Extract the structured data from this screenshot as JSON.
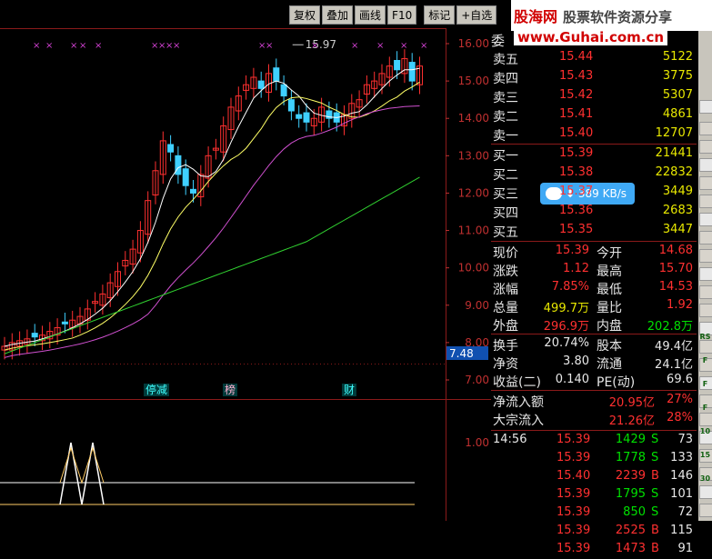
{
  "toolbar": {
    "buttons": [
      "复权",
      "叠加",
      "画线",
      "F10",
      "标记",
      "+自选"
    ]
  },
  "logo": {
    "brand": "股海网",
    "slogan": "股票软件资源分享",
    "url": "www.Guhai.com.cn"
  },
  "chart": {
    "price_axis_ticks": [
      "16.00",
      "15.00",
      "14.00",
      "13.00",
      "12.00",
      "11.00",
      "10.00",
      "9.00",
      "8.00",
      "7.00"
    ],
    "indicator_axis_ticks": [
      "1.00"
    ],
    "high_annotation": "15.97",
    "current_price_marker": "7.48",
    "event_labels": [
      "停减",
      "榜",
      "财"
    ],
    "colors": {
      "up": "#ff3030",
      "down": "#3fd0ff",
      "ma1": "#ffffff",
      "ma2": "#ffff66",
      "ma3": "#d050d0",
      "ma4": "#30d030"
    }
  },
  "order_book": {
    "title": "委",
    "asks": [
      {
        "label": "卖五",
        "price": "15.44",
        "vol": "5122"
      },
      {
        "label": "卖四",
        "price": "15.43",
        "vol": "3775"
      },
      {
        "label": "卖三",
        "price": "15.42",
        "vol": "5307"
      },
      {
        "label": "卖二",
        "price": "15.41",
        "vol": "4861"
      },
      {
        "label": "卖一",
        "price": "15.40",
        "vol": "12707"
      }
    ],
    "bids": [
      {
        "label": "买一",
        "price": "15.39",
        "vol": "21441"
      },
      {
        "label": "买二",
        "price": "15.38",
        "vol": "22832"
      },
      {
        "label": "买三",
        "price": "15.37",
        "vol": "3449"
      },
      {
        "label": "买四",
        "price": "15.36",
        "vol": "2683"
      },
      {
        "label": "买五",
        "price": "15.35",
        "vol": "3447"
      }
    ]
  },
  "speed_badge": "389 KB/s",
  "quote": {
    "rows": [
      {
        "l1": "现价",
        "v1": "15.39",
        "l2": "今开",
        "v2": "14.68"
      },
      {
        "l1": "涨跌",
        "v1": "1.12",
        "l2": "最高",
        "v2": "15.70"
      },
      {
        "l1": "涨幅",
        "v1": "7.85%",
        "l2": "最低",
        "v2": "14.53"
      },
      {
        "l1": "总量",
        "v1": "499.7万",
        "l2": "量比",
        "v2": "1.92"
      },
      {
        "l1": "外盘",
        "v1": "296.9万",
        "l2": "内盘",
        "v2": "202.8万"
      }
    ]
  },
  "fundamentals": {
    "rows": [
      {
        "l1": "换手",
        "v1": "20.74%",
        "l2": "股本",
        "v2": "49.4亿"
      },
      {
        "l1": "净资",
        "v1": "3.80",
        "l2": "流通",
        "v2": "24.1亿"
      },
      {
        "l1": "收益(二)",
        "v1": "0.140",
        "l2": "PE(动)",
        "v2": "69.6"
      }
    ]
  },
  "flows": [
    {
      "label": "净流入额",
      "amount": "20.95亿",
      "pct": "27%"
    },
    {
      "label": "大宗流入",
      "amount": "21.26亿",
      "pct": "28%"
    }
  ],
  "ticks": [
    {
      "time": "14:56",
      "price": "15.39",
      "vol": "1429",
      "side": "S",
      "count": "73"
    },
    {
      "time": "",
      "price": "15.39",
      "vol": "1778",
      "side": "S",
      "count": "133"
    },
    {
      "time": "",
      "price": "15.40",
      "vol": "2239",
      "side": "B",
      "count": "146"
    },
    {
      "time": "",
      "price": "15.39",
      "vol": "1795",
      "side": "S",
      "count": "101"
    },
    {
      "time": "",
      "price": "15.39",
      "vol": "850",
      "side": "S",
      "count": "72"
    },
    {
      "time": "",
      "price": "15.39",
      "vol": "2525",
      "side": "B",
      "count": "115"
    },
    {
      "time": "",
      "price": "15.39",
      "vol": "1473",
      "side": "B",
      "count": "91"
    }
  ],
  "sidebar": {
    "icons": [
      "RS",
      "F",
      "F",
      "F",
      "10",
      "15",
      "30"
    ]
  }
}
